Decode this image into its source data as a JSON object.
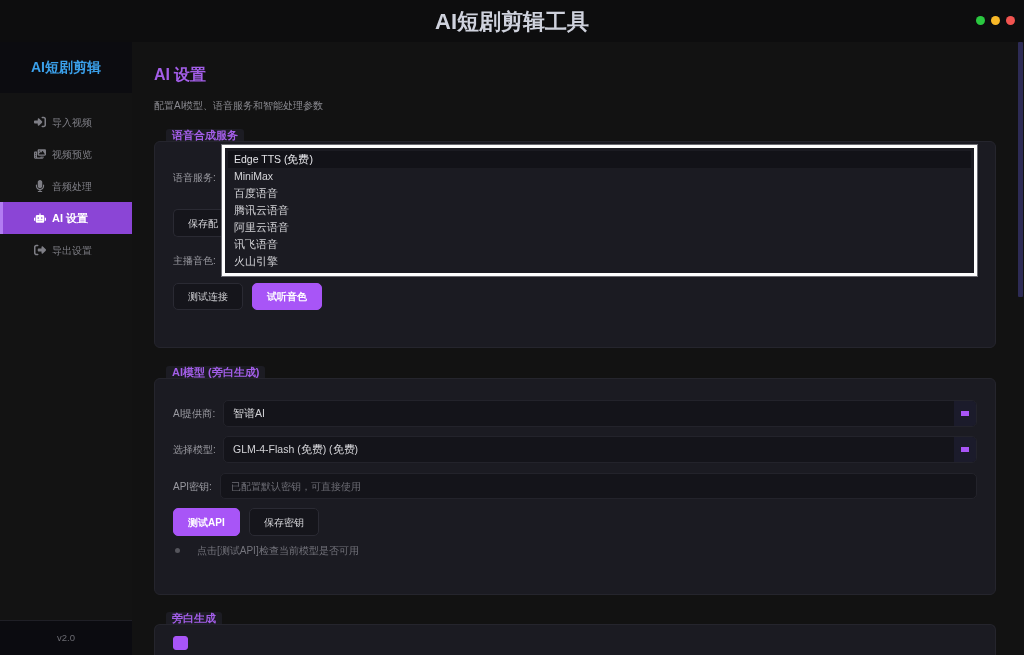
{
  "window": {
    "title": "AI短剧剪辑工具",
    "controls": [
      {
        "color": "#2ac840"
      },
      {
        "color": "#f8b827"
      },
      {
        "color": "#f25450"
      }
    ]
  },
  "sidebar": {
    "brand": "AI短剧剪辑",
    "items": [
      {
        "label": "导入视频",
        "selected": false
      },
      {
        "label": "视频预览",
        "selected": false
      },
      {
        "label": "音频处理",
        "selected": false
      },
      {
        "label": "AI 设置",
        "selected": true
      },
      {
        "label": "导出设置",
        "selected": false
      }
    ],
    "version": "v2.0"
  },
  "page": {
    "title": "AI 设置",
    "subtitle": "配置AI模型、语音服务和智能处理参数"
  },
  "tts_section": {
    "legend": "语音合成服务",
    "service_label": "语音服务:",
    "service_dropdown": {
      "expanded": true,
      "options": [
        {
          "label": "Edge TTS (免费)",
          "selected": true
        },
        {
          "label": "MiniMax",
          "selected": false
        },
        {
          "label": "百度语音",
          "selected": false
        },
        {
          "label": "腾讯云语音",
          "selected": false
        },
        {
          "label": "阿里云语音",
          "selected": false
        },
        {
          "label": "讯飞语音",
          "selected": false
        },
        {
          "label": "火山引擎",
          "selected": false
        }
      ]
    },
    "save_button": "保存配",
    "voice_label": "主播音色:",
    "buttons": [
      {
        "label": "测试连接",
        "kind": "secondary"
      },
      {
        "label": "试听音色",
        "kind": "primary"
      }
    ]
  },
  "model_section": {
    "legend": "AI模型 (旁白生成)",
    "fields": [
      {
        "kind": "select",
        "label": "AI提供商:",
        "value": "智谱AI"
      },
      {
        "kind": "select",
        "label": "选择模型:",
        "value": "GLM-4-Flash (免费) (免费)"
      },
      {
        "kind": "input",
        "label": "API密钥:",
        "placeholder": "已配置默认密钥，可直接使用"
      }
    ],
    "buttons": [
      {
        "label": "测试API",
        "kind": "primary"
      },
      {
        "label": "保存密钥",
        "kind": "secondary"
      }
    ],
    "hint": "点击[测试API]检查当前模型是否可用"
  },
  "narration_section": {
    "legend": "旁白生成",
    "enable_checkbox": {
      "checked": true
    }
  }
}
